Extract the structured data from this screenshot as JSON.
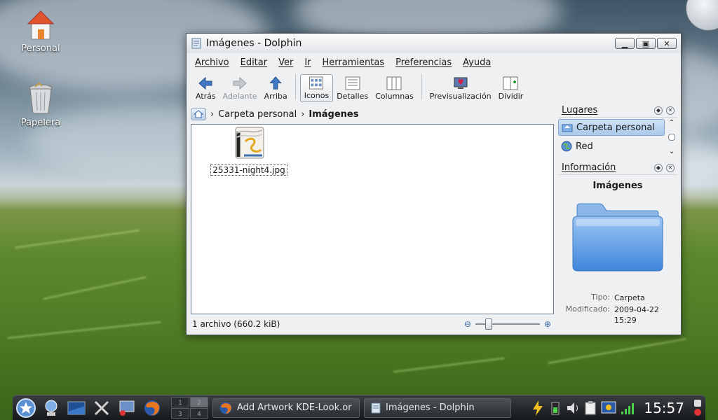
{
  "desktop": {
    "icons": [
      {
        "label": "Personal",
        "icon": "home-icon"
      },
      {
        "label": "Papelera",
        "icon": "trash-icon"
      }
    ]
  },
  "window": {
    "title": "Imágenes - Dolphin",
    "menu": [
      "Archivo",
      "Editar",
      "Ver",
      "Ir",
      "Herramientas",
      "Preferencias",
      "Ayuda"
    ],
    "toolbar": {
      "back": "Atrás",
      "forward": "Adelante",
      "up": "Arriba",
      "icons": "Iconos",
      "details": "Detalles",
      "columns": "Columnas",
      "preview": "Previsualización",
      "split": "Dividir"
    },
    "breadcrumb": {
      "parent": "Carpeta personal",
      "current": "Imágenes"
    },
    "files": [
      {
        "name": "25331-night4.jpg"
      }
    ],
    "status": "1 archivo (660.2 kiB)",
    "places": {
      "title": "Lugares",
      "items": [
        {
          "label": "Carpeta personal",
          "selected": true
        },
        {
          "label": "Red",
          "selected": false
        }
      ]
    },
    "info": {
      "title": "Información",
      "name": "Imágenes",
      "type_label": "Tipo:",
      "type_value": "Carpeta",
      "modified_label": "Modificado:",
      "modified_value": "2009-04-22 15:29"
    }
  },
  "taskbar": {
    "pager": [
      "1",
      "2",
      "3",
      "4"
    ],
    "tasks": [
      {
        "label": "Add Artwork KDE-Look.or"
      },
      {
        "label": "Imágenes - Dolphin"
      }
    ],
    "clock": "15:57"
  },
  "colors": {
    "selection": "#a9c9ea",
    "folder": "#6aa3e6",
    "taskbar": "#1e2124"
  }
}
